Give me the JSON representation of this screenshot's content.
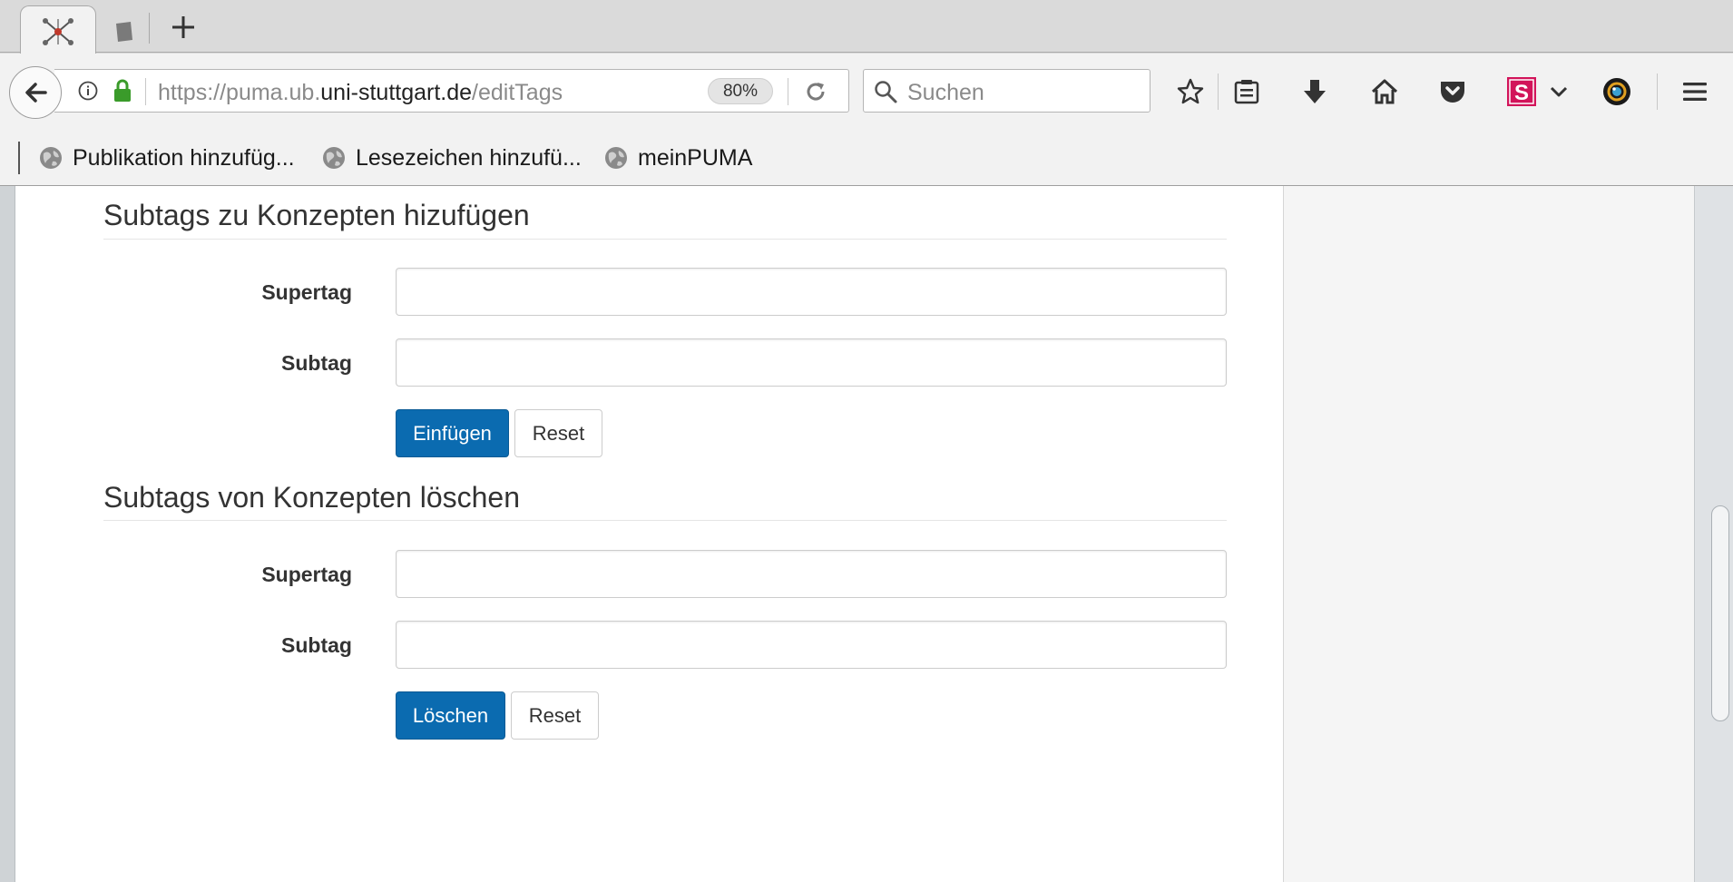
{
  "browser": {
    "url_prefix": "https://puma.ub.",
    "url_domain": "uni-stuttgart.de",
    "url_path": "/editTags",
    "zoom": "80%",
    "search_placeholder": "Suchen",
    "icons": [
      "back-icon",
      "info-icon",
      "lock-icon",
      "reload-icon",
      "search-icon",
      "bookmark-star-icon",
      "reading-list-icon",
      "download-icon",
      "home-icon",
      "pocket-icon",
      "s-extension-icon",
      "chevron-down-icon",
      "camera-extension-icon",
      "menu-icon",
      "new-tab-icon"
    ]
  },
  "bookmarks": [
    {
      "label": "Publikation hinzufüg..."
    },
    {
      "label": "Lesezeichen hinzufü..."
    },
    {
      "label": "meinPUMA"
    }
  ],
  "sections": {
    "add": {
      "title": "Subtags zu Konzepten hizufügen",
      "supertag_label": "Supertag",
      "subtag_label": "Subtag",
      "supertag_value": "",
      "subtag_value": "",
      "submit_label": "Einfügen",
      "reset_label": "Reset"
    },
    "delete": {
      "title": "Subtags von Konzepten löschen",
      "supertag_label": "Supertag",
      "subtag_label": "Subtag",
      "supertag_value": "",
      "subtag_value": "",
      "submit_label": "Löschen",
      "reset_label": "Reset"
    }
  },
  "colors": {
    "primary_button": "#0b6bb0",
    "lock_green": "#3a9b2a",
    "s_extension": "#d2145a"
  }
}
